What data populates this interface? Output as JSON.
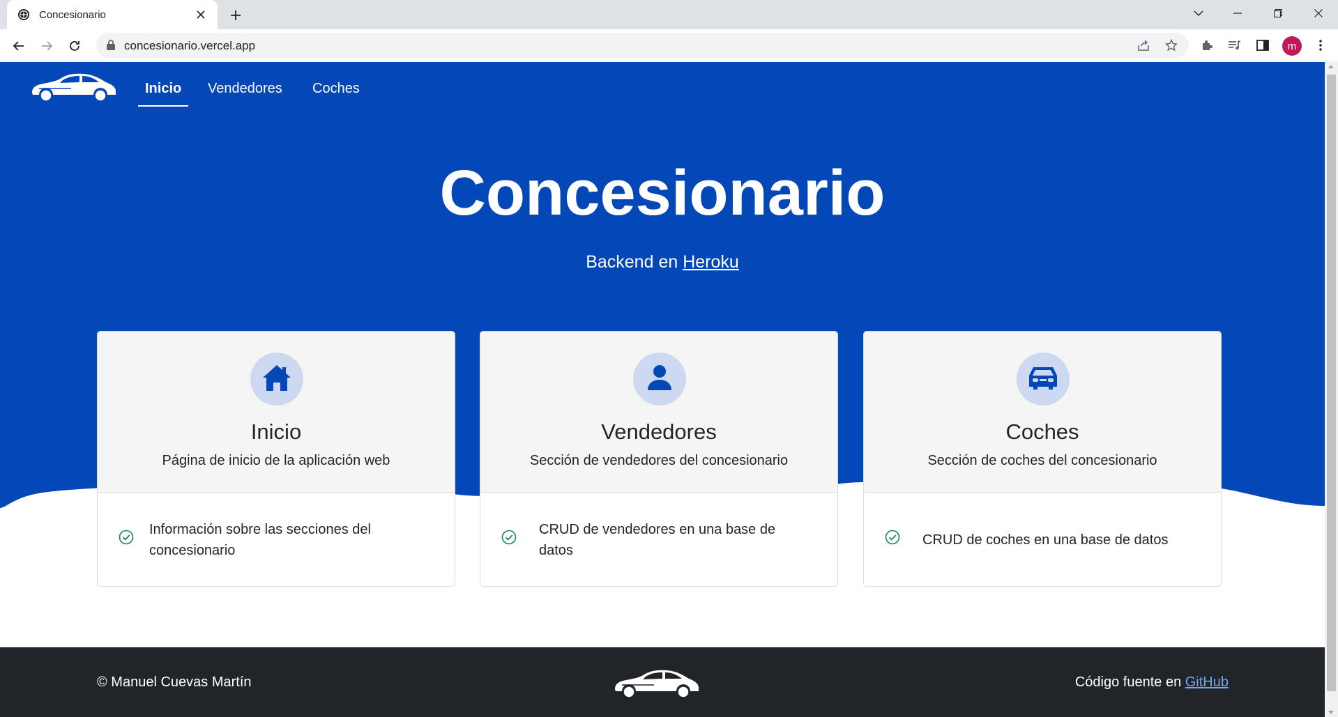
{
  "browser": {
    "tab_title": "Concesionario",
    "url": "concesionario.vercel.app",
    "avatar_letter": "m"
  },
  "nav": {
    "items": [
      {
        "label": "Inicio",
        "active": true
      },
      {
        "label": "Vendedores",
        "active": false
      },
      {
        "label": "Coches",
        "active": false
      }
    ]
  },
  "hero": {
    "title": "Concesionario",
    "subtitle_prefix": "Backend en",
    "subtitle_link": "Heroku"
  },
  "cards": [
    {
      "icon": "home-icon",
      "title": "Inicio",
      "description": "Página de inicio de la aplicación web",
      "item": "Información sobre las secciones del concesionario"
    },
    {
      "icon": "user-icon",
      "title": "Vendedores",
      "description": "Sección de vendedores del concesionario",
      "item": "CRUD de vendedores en una base de datos"
    },
    {
      "icon": "car-icon",
      "title": "Coches",
      "description": "Sección de coches del concesionario",
      "item": "CRUD de coches en una base de datos"
    }
  ],
  "footer": {
    "copyright": "© Manuel Cuevas Martín",
    "source_prefix": "Código fuente en",
    "source_link": "GitHub"
  },
  "colors": {
    "brand_blue": "#0447b7",
    "icon_circle": "#cdd9f0",
    "footer_bg": "#212529",
    "check_green": "#198754"
  }
}
